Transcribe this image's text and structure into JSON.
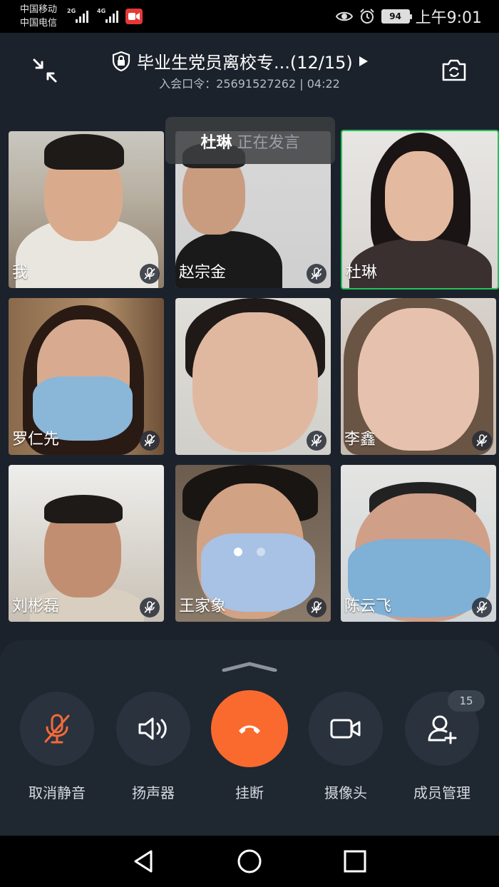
{
  "status_bar": {
    "carrier1": "中国移动",
    "carrier2": "中国电信",
    "net1": "2G",
    "net2": "4G",
    "battery": "94",
    "time": "上午9:01",
    "icons": [
      "eye-comfort-icon",
      "alarm-icon",
      "screen-record-icon"
    ]
  },
  "header": {
    "title": "毕业生党员离校专...(12/15)",
    "subtitle": "入会口令：25691527262 | 04:22"
  },
  "speaking_banner": {
    "name": "杜琳",
    "text": "正在发言"
  },
  "participants": [
    {
      "name": "我",
      "muted": true,
      "active": false
    },
    {
      "name": "赵宗金",
      "muted": true,
      "active": false
    },
    {
      "name": "杜琳",
      "muted": false,
      "active": true
    },
    {
      "name": "罗仁先",
      "muted": true,
      "active": false
    },
    {
      "name": "",
      "muted": true,
      "active": false
    },
    {
      "name": "李鑫",
      "muted": true,
      "active": false
    },
    {
      "name": "刘彬磊",
      "muted": true,
      "active": false
    },
    {
      "name": "王家象",
      "muted": true,
      "active": false
    },
    {
      "name": "陈云飞",
      "muted": true,
      "active": false
    }
  ],
  "controls": {
    "unmute": "取消静音",
    "speaker": "扬声器",
    "hangup": "挂断",
    "camera": "摄像头",
    "members": "成员管理",
    "members_count": "15"
  },
  "colors": {
    "accent_hangup": "#fa6a2e",
    "active_border": "#26c25a",
    "mute_icon": "#f26a3a"
  }
}
